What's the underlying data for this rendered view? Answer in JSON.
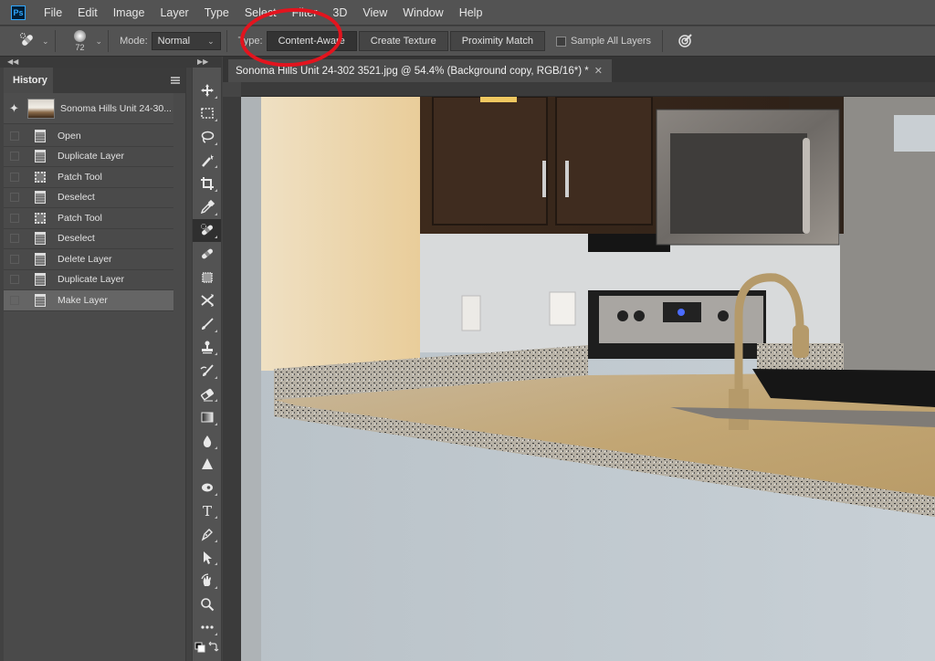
{
  "app": {
    "name": "Photoshop",
    "logo_text": "Ps",
    "accent": "#31a8ff"
  },
  "menu": [
    "File",
    "Edit",
    "Image",
    "Layer",
    "Type",
    "Select",
    "Filter",
    "3D",
    "View",
    "Window",
    "Help"
  ],
  "options_bar": {
    "tool_icon": "patch-tool-icon",
    "brush_size": "72",
    "mode_label": "Mode:",
    "mode_value": "Normal",
    "type_label": "Type:",
    "type_buttons": [
      "Content-Aware",
      "Create Texture",
      "Proximity Match"
    ],
    "type_selected": "Content-Aware",
    "sample_all_layers_label": "Sample All Layers",
    "sample_all_layers_checked": false,
    "pressure_icon": "pressure-size-icon"
  },
  "history_panel": {
    "tab": "History",
    "snapshot_label": "Sonoma Hills Unit 24-30...",
    "items": [
      {
        "label": "Open",
        "icon": "document-icon"
      },
      {
        "label": "Duplicate Layer",
        "icon": "document-icon"
      },
      {
        "label": "Patch Tool",
        "icon": "patch-icon"
      },
      {
        "label": "Deselect",
        "icon": "document-icon"
      },
      {
        "label": "Patch Tool",
        "icon": "patch-icon"
      },
      {
        "label": "Deselect",
        "icon": "document-icon"
      },
      {
        "label": "Delete Layer",
        "icon": "document-icon"
      },
      {
        "label": "Duplicate Layer",
        "icon": "document-icon"
      },
      {
        "label": "Make Layer",
        "icon": "document-icon",
        "current": true
      }
    ]
  },
  "toolbar": {
    "tools": [
      "move-tool",
      "marquee-tool",
      "lasso-tool",
      "magic-wand-tool",
      "crop-tool",
      "eyedropper-tool",
      "spot-healing-brush-tool",
      "healing-brush-tool",
      "patch-tool",
      "content-aware-move-tool",
      "brush-tool",
      "clone-stamp-tool",
      "history-brush-tool",
      "eraser-tool",
      "gradient-tool",
      "blur-tool",
      "sharpen-tool",
      "dodge-tool",
      "type-tool",
      "pen-tool",
      "path-selection-tool",
      "hand-rotate-tool",
      "zoom-tool",
      "more-tools"
    ],
    "active_tool": "spot-healing-brush-tool"
  },
  "document": {
    "tab_title": "Sonoma Hills Unit 24-302 3521.jpg @ 54.4% (Background copy, RGB/16*) *",
    "filename": "Sonoma Hills Unit 24-302 3521.jpg",
    "zoom": "54.4%",
    "layer": "Background copy",
    "color_mode": "RGB/16"
  },
  "annotation": {
    "shape": "circle",
    "color": "#e3141e",
    "target": "Content-Aware"
  }
}
